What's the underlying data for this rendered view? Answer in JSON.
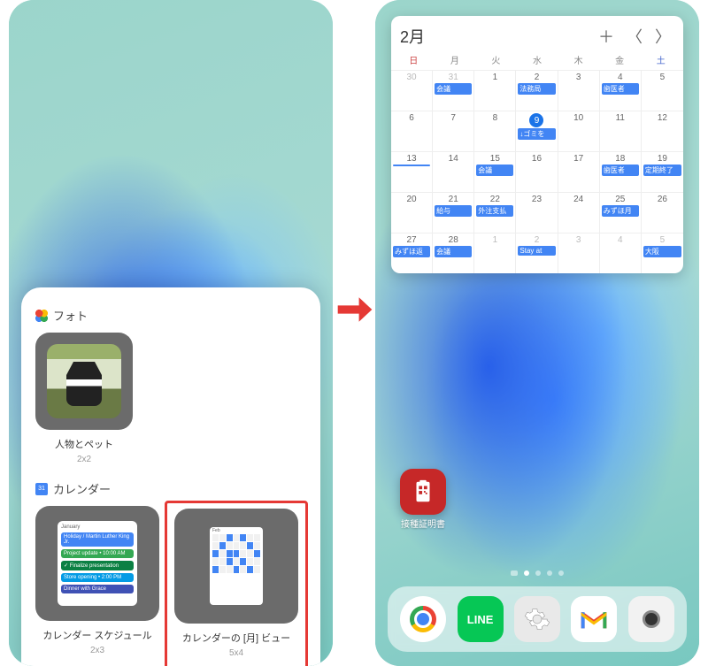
{
  "left": {
    "photos_section": "フォト",
    "photos_widget": {
      "title": "人物とペット",
      "size": "2x2"
    },
    "calendar_section": "カレンダー",
    "schedule_widget": {
      "title": "カレンダー スケジュール",
      "size": "2x3"
    },
    "month_widget": {
      "title": "カレンダーの [月] ビュー",
      "size": "5x4"
    }
  },
  "right": {
    "calendar": {
      "month_label": "2月",
      "dow": [
        "日",
        "月",
        "火",
        "水",
        "木",
        "金",
        "土"
      ],
      "weeks": [
        [
          {
            "d": "30",
            "other": true
          },
          {
            "d": "31",
            "other": true,
            "ev": "会議"
          },
          {
            "d": "1"
          },
          {
            "d": "2",
            "ev": "法務局"
          },
          {
            "d": "3"
          },
          {
            "d": "4",
            "ev": "歯医者"
          },
          {
            "d": "5"
          }
        ],
        [
          {
            "d": "6"
          },
          {
            "d": "7"
          },
          {
            "d": "8"
          },
          {
            "d": "9",
            "today": true,
            "ev": "↓ゴミを"
          },
          {
            "d": "10"
          },
          {
            "d": "11"
          },
          {
            "d": "12"
          }
        ],
        [
          {
            "d": "13",
            "ev": " "
          },
          {
            "d": "14"
          },
          {
            "d": "15",
            "ev": "会議"
          },
          {
            "d": "16"
          },
          {
            "d": "17"
          },
          {
            "d": "18",
            "ev": "歯医者"
          },
          {
            "d": "19",
            "ev": "定期終了"
          }
        ],
        [
          {
            "d": "20"
          },
          {
            "d": "21",
            "ev": "給与"
          },
          {
            "d": "22",
            "ev": "外注支払"
          },
          {
            "d": "23"
          },
          {
            "d": "24"
          },
          {
            "d": "25",
            "ev": "みずほ月"
          },
          {
            "d": "26"
          }
        ],
        [
          {
            "d": "27",
            "ev": "みずほ返"
          },
          {
            "d": "28",
            "ev": "会議"
          },
          {
            "d": "1",
            "other": true
          },
          {
            "d": "2",
            "other": true,
            "ev": "Stay at"
          },
          {
            "d": "3",
            "other": true
          },
          {
            "d": "4",
            "other": true
          },
          {
            "d": "5",
            "other": true,
            "ev": "大阪"
          }
        ]
      ]
    },
    "app": {
      "label": "接種証明書"
    },
    "dock": {
      "line_text": "LINE"
    }
  }
}
